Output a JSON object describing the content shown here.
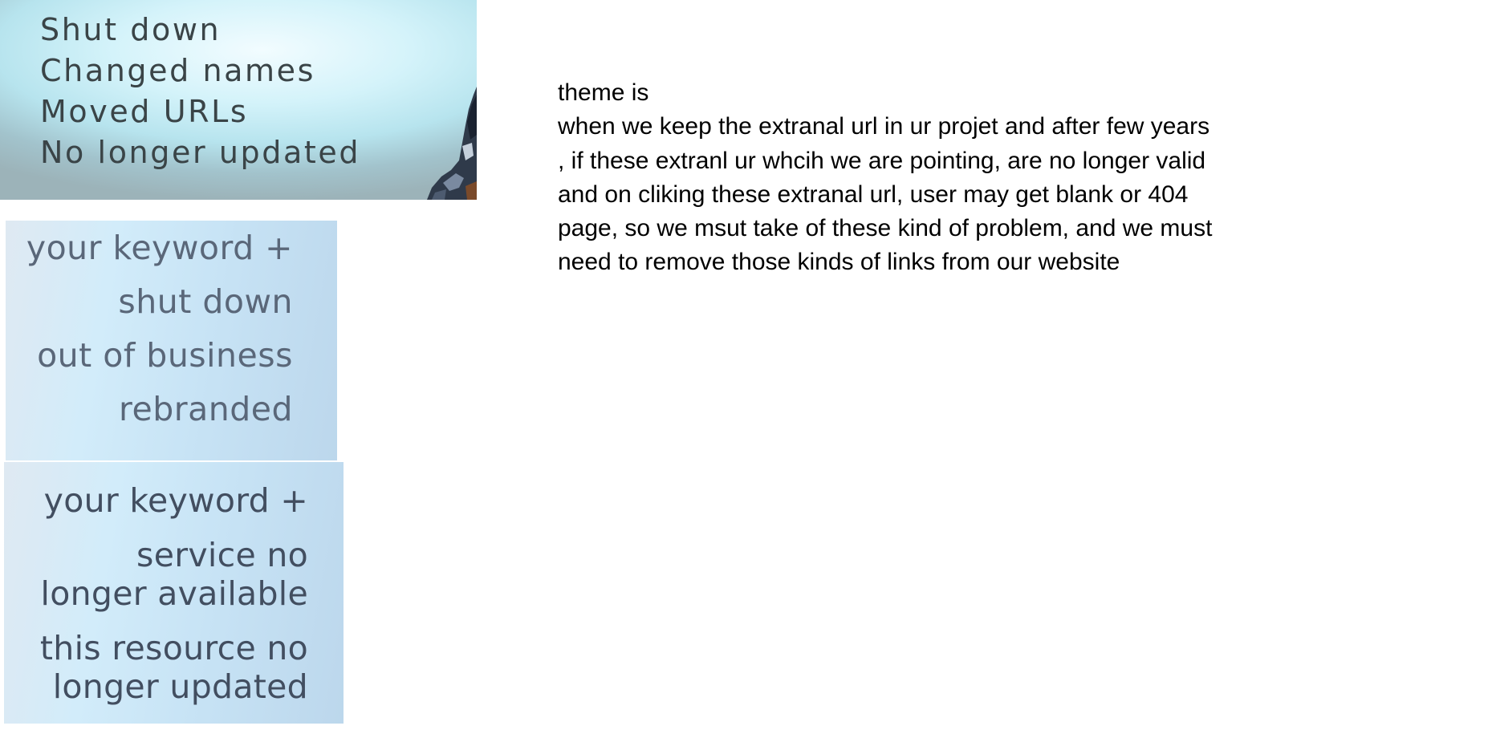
{
  "banner": {
    "items": [
      "Shut down",
      "Changed names",
      "Moved URLs",
      "No longer updated"
    ]
  },
  "card_one": {
    "lines": [
      "your keyword +",
      "shut down",
      "out of business",
      "rebranded"
    ]
  },
  "card_two": {
    "lines": [
      "your keyword +",
      "service no\nlonger available",
      "this resource no\nlonger updated"
    ]
  },
  "note": {
    "heading": "theme is",
    "body": "when we keep the extranal url in ur projet and after few years , if these extranl ur whcih we are pointing, are no longer valid and on cliking these extranal url, user may get blank or 404 page, so we msut take of these kind of problem, and we must need to remove those kinds of links from our website"
  },
  "colors": {
    "banner_text": "#3a4447",
    "card_one_text": "#5a6779",
    "card_two_text": "#424e60",
    "note_text": "#000000"
  }
}
